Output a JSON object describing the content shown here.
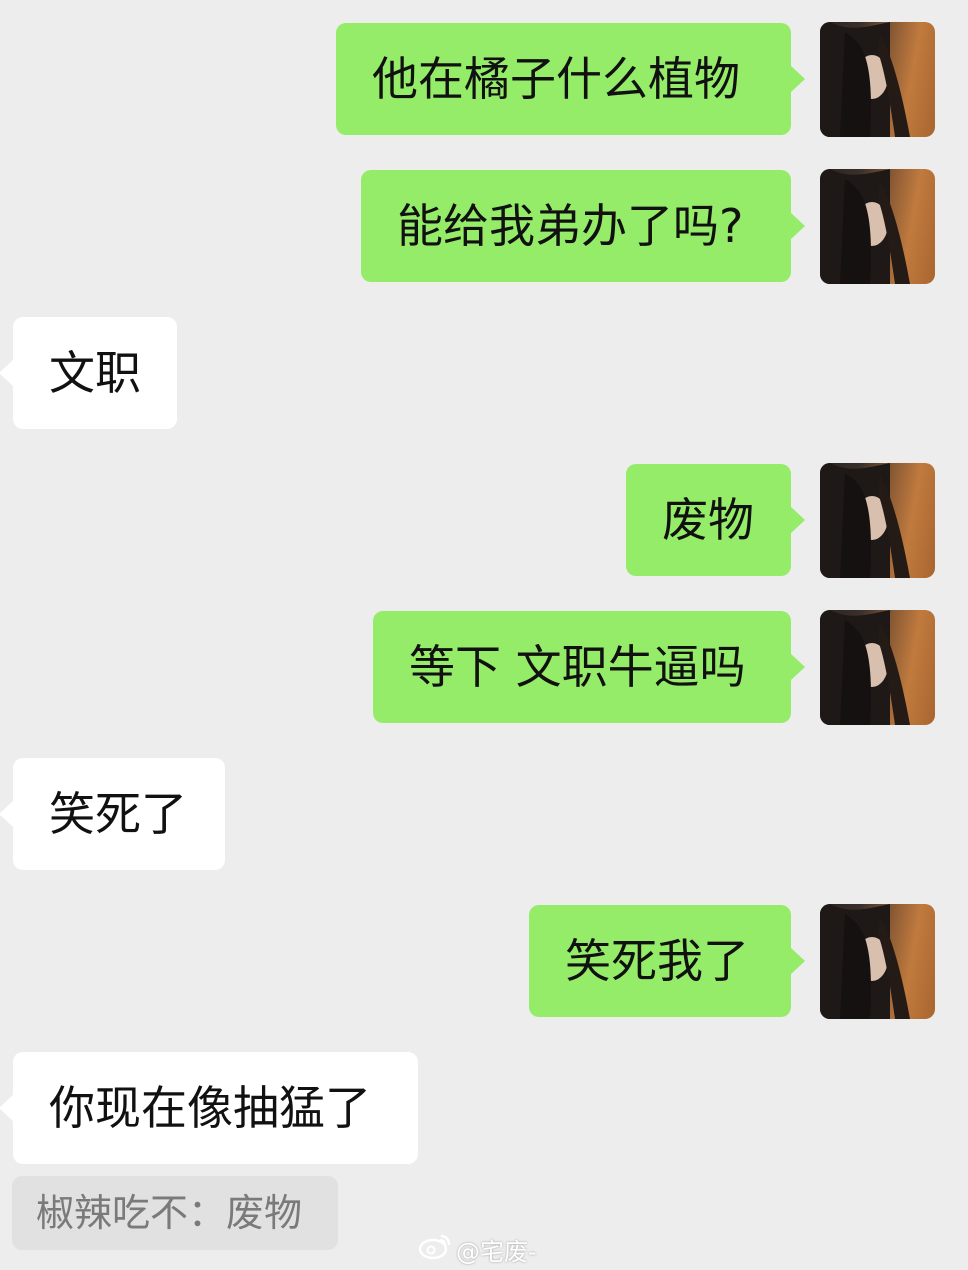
{
  "messages": [
    {
      "side": "me",
      "text": "他在橘子什么植物"
    },
    {
      "side": "me",
      "text": "能给我弟办了吗?"
    },
    {
      "side": "other",
      "text": "文职"
    },
    {
      "side": "me",
      "text": "废物"
    },
    {
      "side": "me",
      "text": "等下 文职牛逼吗"
    },
    {
      "side": "other",
      "text": "笑死了"
    },
    {
      "side": "me",
      "text": "笑死我了"
    },
    {
      "side": "other",
      "text": "你现在像抽猛了"
    }
  ],
  "quoted_reply": {
    "text": "椒辣吃不：废物"
  },
  "watermark": {
    "icon": "weibo-icon",
    "text": "@宅废-"
  },
  "colors": {
    "background": "#ededed",
    "my_bubble": "#95ec69",
    "other_bubble": "#ffffff",
    "quote_bg": "#e1e1e1"
  }
}
